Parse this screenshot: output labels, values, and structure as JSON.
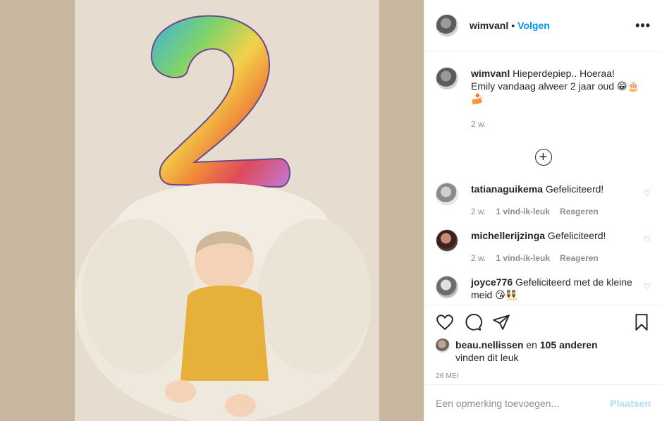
{
  "post": {
    "author": "wimvanl",
    "follow_label": "Volgen",
    "separator": "•",
    "more_label": "•••"
  },
  "caption": {
    "username": "wimvanl",
    "text": " Hieperdepiep.. Hoeraa! Emily vandaag alweer 2 jaar oud 😁🎂🍰",
    "time": "2 w."
  },
  "comments": [
    {
      "username": "tatianaguikema",
      "text": " Gefeliciteerd!",
      "time": "2 w.",
      "likes": "1 vind-ik-leuk",
      "reply": "Reageren"
    },
    {
      "username": "michellerijzinga",
      "text": " Gefeliciteerd!",
      "time": "2 w.",
      "likes": "1 vind-ik-leuk",
      "reply": "Reageren"
    },
    {
      "username": "joyce776",
      "text": " Gefeliciteerd met de kleine meid 😘👯",
      "time": "",
      "likes": "",
      "reply": ""
    }
  ],
  "likes": {
    "first_user": "beau.nellissen",
    "connector": " en ",
    "others": "105 anderen",
    "suffix": "vinden dit leuk"
  },
  "date": "26 MEI",
  "add_comment": {
    "placeholder": "Een opmerking toevoegen...",
    "post_label": "Plaatsen"
  },
  "colors": {
    "link": "#0095f6",
    "muted": "#8e8e8e",
    "post_disabled": "#b2dffc"
  },
  "icons": [
    "heart-icon",
    "comment-icon",
    "share-icon",
    "bookmark-icon",
    "plus-circle-icon"
  ]
}
